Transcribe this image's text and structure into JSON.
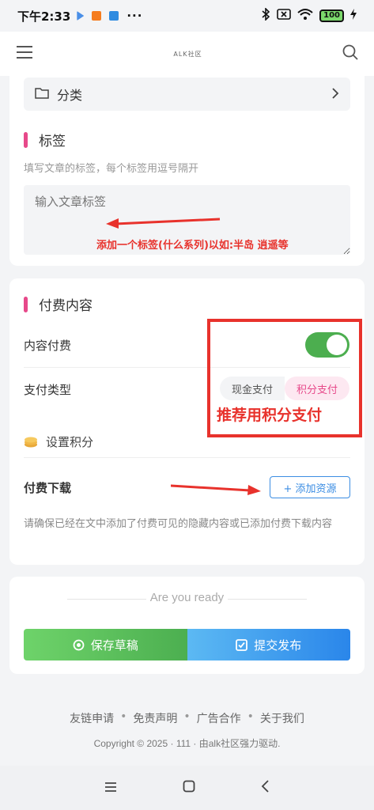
{
  "status_bar": {
    "time": "下午2:33",
    "battery": "100"
  },
  "app_bar": {
    "logo_text": "ALK社区"
  },
  "category": {
    "label": "分类"
  },
  "tags": {
    "title": "标签",
    "hint": "填写文章的标签，每个标签用逗号隔开",
    "placeholder": "输入文章标签",
    "annotation": "添加一个标签(什么系列)以如:半岛 逍遥等"
  },
  "paid": {
    "title": "付费内容",
    "content_paid_label": "内容付费",
    "toggle_on": true,
    "pay_type_label": "支付类型",
    "pay_options": [
      "现金支付",
      "积分支付"
    ],
    "selected": "积分支付",
    "annotation": "推荐用积分支付",
    "set_points_label": "设置积分",
    "download_label": "付费下载",
    "add_resource": "+ 添加资源",
    "note": "请确保已经在文中添加了付费可见的隐藏内容或已添加付费下载内容"
  },
  "actions": {
    "ready_text": "Are you ready",
    "save_draft": "保存草稿",
    "submit": "提交发布"
  },
  "footer": {
    "links": [
      "友链申请",
      "免责声明",
      "广告合作",
      "关于我们"
    ],
    "copyright": "Copyright © 2025 · 111 · 由alk社区强力驱动."
  },
  "colors": {
    "accent_pink": "#e7498a",
    "annotation_red": "#e8322c",
    "toggle_green": "#4cae4f",
    "link_blue": "#3b8de3"
  }
}
